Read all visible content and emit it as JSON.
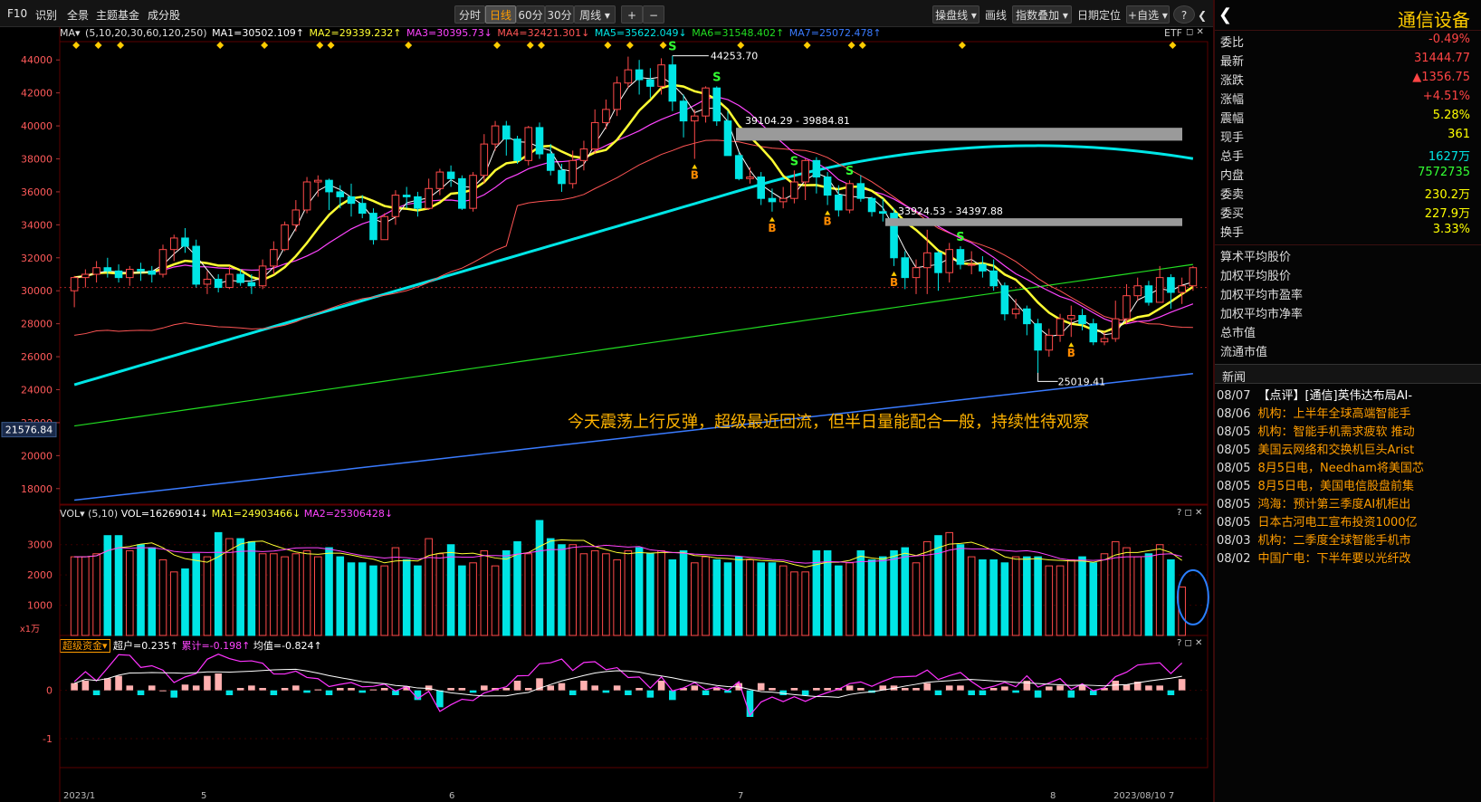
{
  "toolbar": {
    "left_items": [
      "F10",
      "识别",
      "全景",
      "主题基金",
      "成分股"
    ],
    "periods": [
      "分时",
      "日线",
      "60分",
      "30分",
      "周线 ▾"
    ],
    "active_period": "日线",
    "zoom_in": "+",
    "zoom_out": "−",
    "right_items": [
      "操盘线 ▾",
      "画线",
      "指数叠加 ▾",
      "日期定位",
      "+自选 ▾",
      "?",
      "❮"
    ]
  },
  "indicators": {
    "ma_menu": "MA▾",
    "ma_params": "(5,10,20,30,60,120,250)",
    "ma_values": [
      "MA1=30502.109↑",
      "MA2=29339.232↑",
      "MA3=30395.73↓",
      "MA4=32421.301↓",
      "MA5=35622.049↓",
      "MA6=31548.402↑",
      "MA7=25072.478↑"
    ],
    "ma_colors": [
      "#ffffff",
      "#ffff33",
      "#ff44ff",
      "#ff5555",
      "#00e6e6",
      "#22dd22",
      "#3a7bff"
    ],
    "etf": "ETF",
    "close_icons": "◻ ✕"
  },
  "price_axis": {
    "labels": [
      "44000",
      "42000",
      "40000",
      "38000",
      "36000",
      "34000",
      "32000",
      "30000",
      "28000",
      "26000",
      "24000",
      "22000",
      "20000",
      "18000"
    ],
    "current": "21576.84"
  },
  "price_annotations": {
    "high": "44253.70",
    "low": "25019.41",
    "zone1": "39104.29 - 39884.81",
    "zone2": "33924.53 - 34397.88"
  },
  "signals": {
    "S": "S",
    "B": "B"
  },
  "volume": {
    "menu": "VOL▾",
    "params": "(5,10)",
    "vol": "VOL=16269014↓",
    "ma1": "MA1=24903466↓",
    "ma2": "MA2=25306428↓",
    "axis": [
      "3000",
      "2000",
      "1000"
    ],
    "unit": "x1万",
    "icons": "? ◻ ✕"
  },
  "capital_flow": {
    "menu": "超级资金▾",
    "super": "超户=0.235↑",
    "cum": "累计=-0.198↑",
    "avg": "均值=-0.824↑",
    "axis": [
      "0",
      "-1"
    ],
    "icons": "? ◻ ✕"
  },
  "annotation_text": "今天震荡上行反弹，超级最近回流，但半日量能配合一般，持续性待观察",
  "bottom_axis": [
    "2023/1",
    "5",
    "6",
    "7",
    "8",
    "2023/08/10 7"
  ],
  "right_panel": {
    "title": "通信设备",
    "back": "❮",
    "quotes": [
      {
        "label": "委比",
        "value": "-0.49%",
        "color": "#ff4444"
      },
      {
        "label": "最新",
        "value": "31444.77",
        "color": "#ff4444"
      },
      {
        "label": "涨跌",
        "value": "▲1356.75",
        "color": "#ff4444"
      },
      {
        "label": "涨幅",
        "value": "+4.51%",
        "color": "#ff4444"
      },
      {
        "label": "震幅",
        "value": "5.28%",
        "color": "#ffff00"
      },
      {
        "label": "现手",
        "value": "361",
        "color": "#ffff00"
      },
      {
        "label": "总手",
        "value": "1627万",
        "color": "#00e6e6"
      },
      {
        "label": "内盘",
        "value": "7572735",
        "color": "#33ff33"
      },
      {
        "label": "委卖",
        "value": "230.2万",
        "color": "#ffff00"
      },
      {
        "label": "委买",
        "value": "227.9万",
        "color": "#ffff00"
      },
      {
        "label": "换手",
        "value": "3.33%",
        "color": "#ffff00"
      }
    ],
    "avg_items": [
      "算术平均股价",
      "加权平均股价",
      "加权平均市盈率",
      "加权平均市净率",
      "总市值",
      "流通市值"
    ],
    "news_header": "新闻",
    "news": [
      {
        "date": "08/07",
        "title": "【点评】[通信]英伟达布局AI-",
        "color": "#ffffff"
      },
      {
        "date": "08/06",
        "title": "机构：上半年全球高端智能手",
        "color": "#ff9d00"
      },
      {
        "date": "08/05",
        "title": "机构：智能手机需求疲软 推动",
        "color": "#ff9d00"
      },
      {
        "date": "08/05",
        "title": "美国云网络和交换机巨头Arist",
        "color": "#ff9d00"
      },
      {
        "date": "08/05",
        "title": "8月5日电，Needham将美国芯",
        "color": "#ff9d00"
      },
      {
        "date": "08/05",
        "title": "8月5日电，美国电信股盘前集",
        "color": "#ff9d00"
      },
      {
        "date": "08/05",
        "title": "鸿海：预计第三季度AI机柜出",
        "color": "#ff9d00"
      },
      {
        "date": "08/05",
        "title": "日本古河电工宣布投资1000亿",
        "color": "#ff9d00"
      },
      {
        "date": "08/03",
        "title": "机构：二季度全球智能手机市",
        "color": "#ff9d00"
      },
      {
        "date": "08/02",
        "title": "中国广电：下半年要以光纤改",
        "color": "#ff9d00"
      }
    ]
  },
  "colors": {
    "up": "#ff4a4a",
    "down": "#00e5e5",
    "grid": "#5a0000",
    "bg": "#000000"
  },
  "chart_data": [
    {
      "type": "candlestick",
      "title": "通信设备 日线",
      "ylim": [
        17000,
        45000
      ],
      "candles": [
        [
          30000,
          30800,
          29000,
          30900
        ],
        [
          30800,
          31000,
          30200,
          31300
        ],
        [
          31000,
          31400,
          30500,
          31800
        ],
        [
          31400,
          31200,
          30800,
          32000
        ],
        [
          31200,
          30800,
          30500,
          31600
        ],
        [
          30800,
          31300,
          30300,
          31500
        ],
        [
          31300,
          31200,
          30600,
          31700
        ],
        [
          31200,
          31000,
          30500,
          31500
        ],
        [
          31000,
          32500,
          30800,
          32800
        ],
        [
          32500,
          33200,
          31800,
          33400
        ],
        [
          33200,
          32700,
          32300,
          33800
        ],
        [
          32700,
          30400,
          30200,
          33100
        ],
        [
          30400,
          30700,
          29800,
          31200
        ],
        [
          30700,
          30200,
          29900,
          31000
        ],
        [
          30200,
          31000,
          30100,
          31500
        ],
        [
          31000,
          30500,
          30300,
          31300
        ],
        [
          30500,
          30300,
          29800,
          31000
        ],
        [
          30300,
          31500,
          30100,
          31900
        ],
        [
          31500,
          32500,
          31000,
          33000
        ],
        [
          32500,
          34000,
          32400,
          34200
        ],
        [
          34000,
          34900,
          33600,
          35500
        ],
        [
          34900,
          36600,
          34700,
          36900
        ],
        [
          36600,
          36700,
          35700,
          37000
        ],
        [
          36700,
          36000,
          34900,
          36800
        ],
        [
          36000,
          35700,
          35000,
          36400
        ],
        [
          35700,
          35300,
          34500,
          36500
        ],
        [
          35300,
          34700,
          34400,
          35800
        ],
        [
          34700,
          33100,
          32800,
          35000
        ],
        [
          33100,
          34500,
          33100,
          34700
        ],
        [
          34500,
          35800,
          34000,
          36100
        ],
        [
          35800,
          35700,
          35000,
          36300
        ],
        [
          35700,
          35000,
          34500,
          36000
        ],
        [
          35000,
          36200,
          34900,
          36800
        ],
        [
          36200,
          37200,
          35800,
          37400
        ],
        [
          37200,
          36800,
          36300,
          37600
        ],
        [
          36800,
          35000,
          34900,
          37000
        ],
        [
          35000,
          37000,
          34800,
          37200
        ],
        [
          37000,
          38900,
          36500,
          39500
        ],
        [
          38900,
          40000,
          38500,
          40300
        ],
        [
          40000,
          39200,
          38200,
          40300
        ],
        [
          39200,
          37900,
          37700,
          39400
        ],
        [
          37900,
          39900,
          37600,
          40000
        ],
        [
          39900,
          38300,
          38000,
          40200
        ],
        [
          38300,
          37300,
          37000,
          38900
        ],
        [
          37300,
          36500,
          36000,
          37700
        ],
        [
          36500,
          37900,
          36200,
          38500
        ],
        [
          37900,
          38600,
          37300,
          39100
        ],
        [
          38600,
          40200,
          38300,
          41000
        ],
        [
          40200,
          41000,
          39800,
          41600
        ],
        [
          41000,
          42600,
          40600,
          43000
        ],
        [
          42600,
          43400,
          42300,
          44200
        ],
        [
          43400,
          42800,
          41900,
          44000
        ],
        [
          42800,
          42400,
          41700,
          43500
        ],
        [
          42400,
          43700,
          41900,
          44100
        ],
        [
          43700,
          41500,
          40900,
          44250
        ],
        [
          41500,
          40300,
          39300,
          41900
        ],
        [
          40300,
          40600,
          38000,
          41000
        ],
        [
          40600,
          42300,
          40200,
          42400
        ],
        [
          42300,
          40300,
          40000,
          42400
        ],
        [
          40300,
          38200,
          39600,
          40900
        ],
        [
          38200,
          36800,
          36700,
          38400
        ],
        [
          36800,
          36900,
          36500,
          37500
        ],
        [
          36900,
          35600,
          35200,
          37200
        ],
        [
          35600,
          35400,
          34800,
          36200
        ],
        [
          35400,
          35600,
          35000,
          36300
        ],
        [
          35600,
          36600,
          35300,
          37300
        ],
        [
          36600,
          37900,
          35500,
          38000
        ],
        [
          37900,
          36900,
          35900,
          38100
        ],
        [
          36900,
          35800,
          35200,
          37200
        ],
        [
          35800,
          34900,
          34500,
          36400
        ],
        [
          34900,
          36500,
          34700,
          36700
        ],
        [
          36500,
          35600,
          35400,
          37000
        ],
        [
          35600,
          34800,
          34500,
          35700
        ],
        [
          34800,
          34700,
          34200,
          35600
        ],
        [
          34700,
          32000,
          31500,
          35000
        ],
        [
          32000,
          30800,
          30100,
          32400
        ],
        [
          30800,
          31400,
          29800,
          31900
        ],
        [
          31400,
          32300,
          29800,
          33700
        ],
        [
          32300,
          31100,
          30000,
          32400
        ],
        [
          31100,
          32500,
          30500,
          32900
        ],
        [
          32500,
          31600,
          31300,
          32700
        ],
        [
          31600,
          31600,
          31000,
          32400
        ],
        [
          31600,
          31200,
          30800,
          32100
        ],
        [
          31200,
          30300,
          30000,
          31900
        ],
        [
          30300,
          28600,
          28200,
          30500
        ],
        [
          28600,
          28900,
          28300,
          29500
        ],
        [
          28900,
          28000,
          27300,
          29100
        ],
        [
          28000,
          26400,
          25000,
          28300
        ],
        [
          26400,
          27300,
          26000,
          27700
        ],
        [
          27300,
          28300,
          26900,
          28600
        ],
        [
          28300,
          28500,
          27200,
          29100
        ],
        [
          28500,
          28000,
          27600,
          28900
        ],
        [
          28000,
          26900,
          26700,
          28300
        ],
        [
          26900,
          27100,
          26700,
          27500
        ],
        [
          27100,
          28300,
          26900,
          29400
        ],
        [
          28300,
          29700,
          28000,
          30400
        ],
        [
          29700,
          30300,
          29400,
          30800
        ],
        [
          30300,
          29300,
          29100,
          30600
        ],
        [
          29300,
          30800,
          29300,
          31500
        ],
        [
          30800,
          29900,
          28900,
          31000
        ],
        [
          29900,
          30300,
          29200,
          30800
        ],
        [
          30300,
          31400,
          30000,
          31500
        ]
      ],
      "ma_lines": [
        "MA1",
        "MA2",
        "MA3",
        "MA4",
        "MA5",
        "MA6",
        "MA7"
      ],
      "annotations": {
        "high": 44253.7,
        "low": 25019.41,
        "resistance_zones": [
          [
            39104.29,
            39884.81
          ],
          [
            33924.53,
            34397.88
          ]
        ]
      }
    },
    {
      "type": "bar",
      "title": "VOL",
      "ylim": [
        0,
        3800
      ],
      "values": [
        2600,
        2600,
        2700,
        3300,
        3300,
        2800,
        3000,
        2900,
        2500,
        2100,
        2200,
        2700,
        2600,
        3400,
        3200,
        3200,
        3100,
        2700,
        2700,
        2600,
        2700,
        2800,
        2600,
        2900,
        2600,
        2400,
        2400,
        2300,
        2300,
        2900,
        2500,
        2300,
        3200,
        2700,
        3000,
        2300,
        2400,
        2800,
        2300,
        2800,
        3100,
        2700,
        3800,
        3200,
        3000,
        3000,
        2700,
        2800,
        2700,
        2500,
        2800,
        2900,
        2700,
        2800,
        2500,
        2800,
        2400,
        2600,
        2500,
        2400,
        2600,
        2500,
        2400,
        2400,
        2300,
        2100,
        2100,
        2800,
        2800,
        2300,
        2400,
        2800,
        2500,
        2600,
        2800,
        2900,
        2400,
        3100,
        3300,
        3400,
        3000,
        2600,
        2500,
        2500,
        2400,
        2600,
        2600,
        2600,
        2300,
        2300,
        2500,
        2600,
        2400,
        2700,
        3100,
        2900,
        2600,
        2700,
        3000,
        2500,
        1600
      ],
      "ma_lines": [
        "MA1",
        "MA2"
      ]
    },
    {
      "type": "bar",
      "title": "超级资金",
      "ylim": [
        -1.6,
        0.8
      ],
      "values": [
        0.15,
        0.2,
        -0.1,
        0.25,
        0.3,
        0.1,
        -0.1,
        0.1,
        0.0,
        -0.15,
        0.12,
        0.1,
        0.3,
        0.35,
        -0.1,
        0.05,
        0.1,
        0.05,
        -0.1,
        0.05,
        0.1,
        -0.05,
        0.02,
        -0.1,
        0.05,
        0.05,
        -0.05,
        0.02,
        0.05,
        -0.1,
        0.08,
        -0.2,
        0.1,
        -0.35,
        0.05,
        0.05,
        -0.05,
        0.1,
        0.05,
        0.05,
        0.2,
        0.05,
        0.25,
        0.1,
        0.15,
        -0.1,
        0.2,
        0.1,
        -0.05,
        0.1,
        -0.1,
        0.05,
        -0.15,
        0.2,
        -0.2,
        0.05,
        0.1,
        -0.1,
        0.05,
        -0.05,
        0.15,
        -0.55,
        0.15,
        0.05,
        -0.1,
        0.05,
        -0.1,
        0.05,
        0.05,
        0.05,
        0.1,
        0.05,
        -0.05,
        0.1,
        0.1,
        0.05,
        0.05,
        0.15,
        -0.1,
        0.1,
        0.1,
        -0.1,
        -0.1,
        0.05,
        0.08,
        -0.05,
        0.2,
        -0.15,
        0.08,
        0.1,
        -0.15,
        0.1,
        -0.1,
        0.05,
        0.2,
        0.12,
        0.18,
        0.1,
        0.1,
        -0.1,
        0.235
      ]
    }
  ]
}
